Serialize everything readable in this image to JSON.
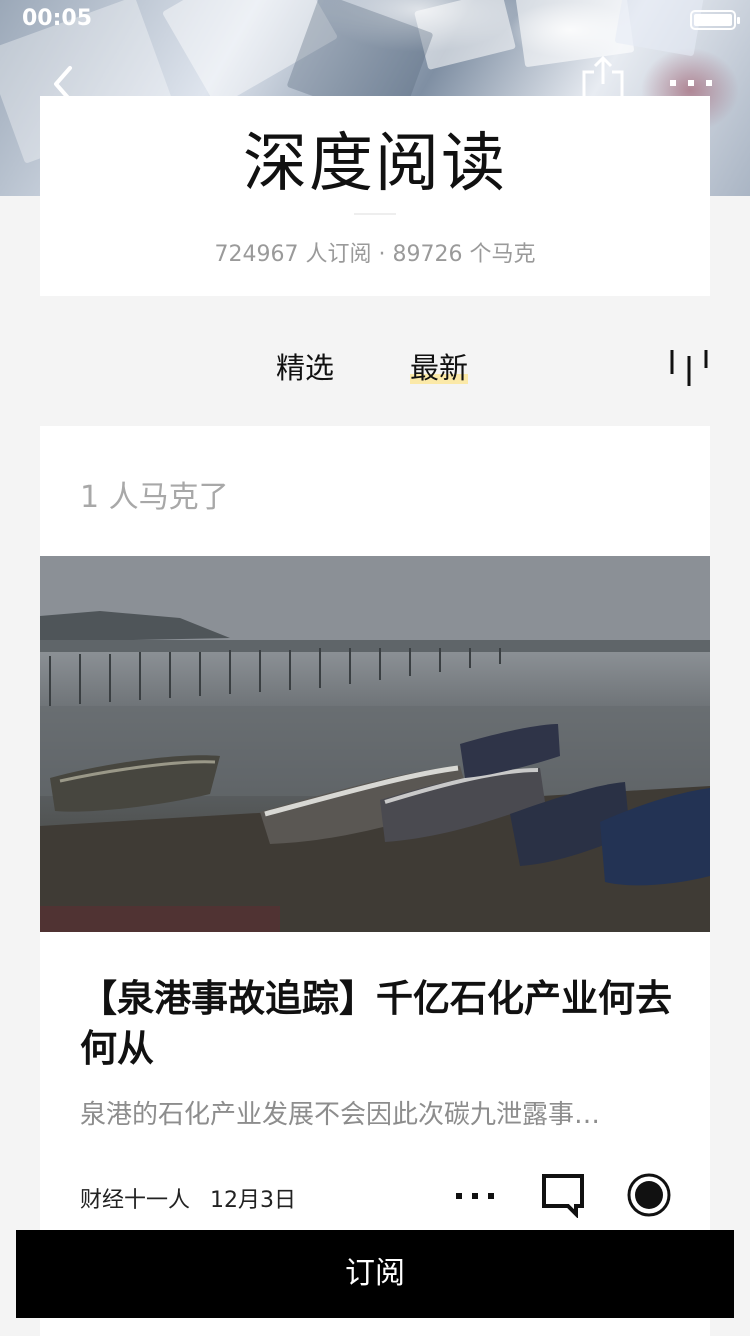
{
  "status_bar": {
    "time": "00:05"
  },
  "nav": {
    "back_icon": "chevron-left-icon",
    "share_icon": "share-icon",
    "more_icon": "more-horizontal-icon"
  },
  "header": {
    "title": "深度阅读",
    "stats": "724967 人订阅 · 89726 个马克"
  },
  "tabs": [
    {
      "label": "精选",
      "active": false
    },
    {
      "label": "最新",
      "active": true
    }
  ],
  "filter_icon": "sort-filter-icon",
  "article": {
    "marked_count": "1 人马克了",
    "title": "【泉港事故追踪】千亿石化产业何去何从",
    "summary": "泉港的石化产业发展不会因此次碳九泄露事…",
    "source": "财经十一人",
    "date": "12月3日",
    "action_icons": [
      "more-horizontal-icon",
      "comment-icon",
      "mark-icon"
    ]
  },
  "subscribe_button": "订阅",
  "colors": {
    "accent_highlight": "#fbe9a8",
    "background": "#f4f4f4",
    "subscribe_bar": "#000000"
  }
}
